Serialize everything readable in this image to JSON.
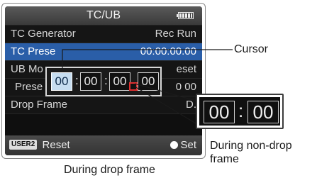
{
  "screen": {
    "title": "TC/UB",
    "battery_icon": "battery-icon",
    "menu_items": [
      {
        "label": "TC Generator",
        "value": "Rec Run"
      },
      {
        "label": "TC Prese",
        "value": "00:00:00.00"
      },
      {
        "label": "UB Mo",
        "value": "eset"
      },
      {
        "label": "Prese",
        "value": "0 00"
      },
      {
        "label": "Drop Frame",
        "value": "D."
      }
    ],
    "bottom_bar": {
      "user_button": "USER2",
      "reset_label": "Reset",
      "set_label": "Set"
    }
  },
  "tc_editor": {
    "fields": [
      "00",
      "00",
      "00",
      "00"
    ],
    "separators": [
      ":",
      ":",
      ""
    ]
  },
  "non_drop_inset": {
    "fields": [
      "00",
      "00"
    ],
    "separator": ":"
  },
  "annotations": {
    "cursor": "Cursor",
    "non_drop": "During non-drop frame",
    "drop": "During drop frame"
  },
  "colors": {
    "highlight": "#2a5ea8",
    "cursor_field": "#c6ddf0",
    "drop_marker": "#e03030"
  }
}
